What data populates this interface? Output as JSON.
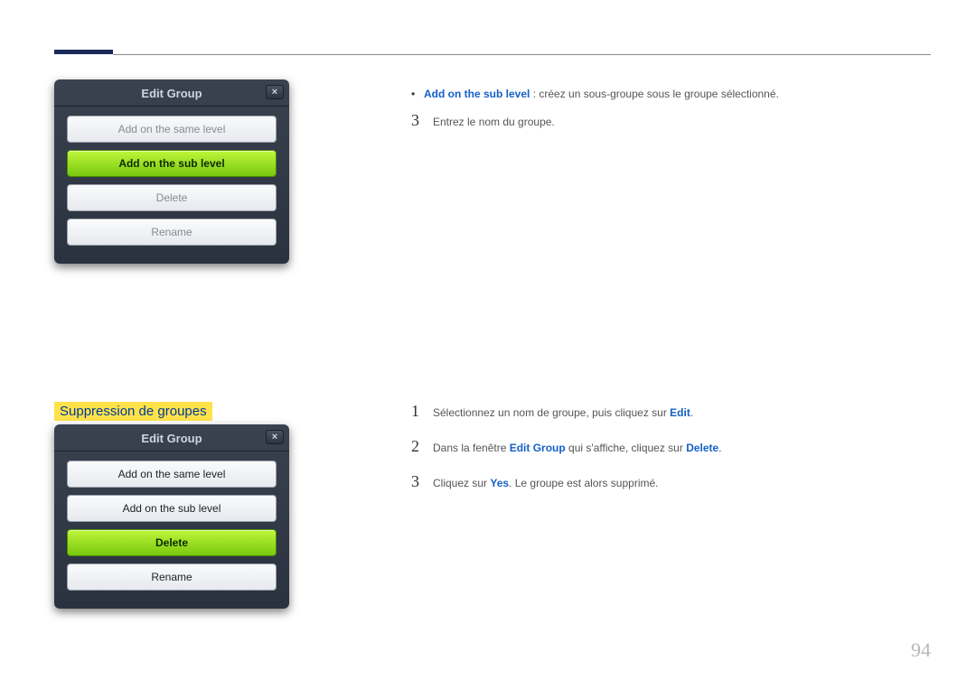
{
  "header": {},
  "dialog1": {
    "title": "Edit Group",
    "close": "×",
    "buttons": {
      "same": "Add on the same level",
      "sub": "Add on the sub level",
      "delete": "Delete",
      "rename": "Rename"
    }
  },
  "dialog2": {
    "title": "Edit Group",
    "close": "×",
    "buttons": {
      "same": "Add on the same level",
      "sub": "Add on the sub level",
      "delete": "Delete",
      "rename": "Rename"
    }
  },
  "section_heading": "Suppression de groupes",
  "top_right": {
    "bullet_bold": "Add on the sub level",
    "bullet_rest": " : créez un sous-groupe sous le groupe sélectionné.",
    "step3_num": "3",
    "step3_text": "Entrez le nom du groupe."
  },
  "mid_right": {
    "step1_num": "1",
    "step1_a": "Sélectionnez un nom de groupe, puis cliquez sur ",
    "step1_b": "Edit",
    "step1_c": ".",
    "step2_num": "2",
    "step2_a": "Dans la fenêtre ",
    "step2_b": "Edit Group",
    "step2_c": " qui s'affiche, cliquez sur ",
    "step2_d": "Delete",
    "step2_e": ".",
    "step3_num": "3",
    "step3_a": "Cliquez sur ",
    "step3_b": "Yes",
    "step3_c": ". Le groupe est alors supprimé."
  },
  "page_number": "94"
}
